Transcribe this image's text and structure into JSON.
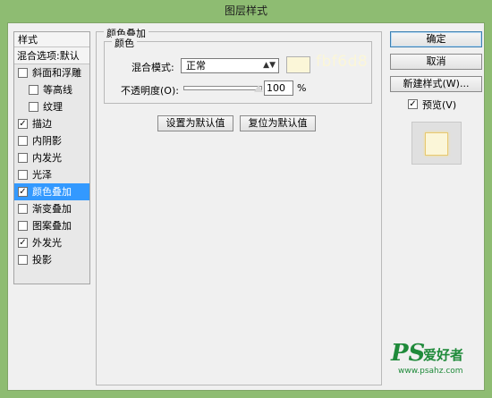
{
  "window": {
    "title": "图层样式"
  },
  "style_list": {
    "header": "样式",
    "blending_options": "混合选项:默认",
    "items": [
      {
        "label": "斜面和浮雕",
        "checked": false,
        "indent": false,
        "selected": false
      },
      {
        "label": "等高线",
        "checked": false,
        "indent": true,
        "selected": false
      },
      {
        "label": "纹理",
        "checked": false,
        "indent": true,
        "selected": false
      },
      {
        "label": "描边",
        "checked": true,
        "indent": false,
        "selected": false
      },
      {
        "label": "内阴影",
        "checked": false,
        "indent": false,
        "selected": false
      },
      {
        "label": "内发光",
        "checked": false,
        "indent": false,
        "selected": false
      },
      {
        "label": "光泽",
        "checked": false,
        "indent": false,
        "selected": false
      },
      {
        "label": "颜色叠加",
        "checked": true,
        "indent": false,
        "selected": true
      },
      {
        "label": "渐变叠加",
        "checked": false,
        "indent": false,
        "selected": false
      },
      {
        "label": "图案叠加",
        "checked": false,
        "indent": false,
        "selected": false
      },
      {
        "label": "外发光",
        "checked": true,
        "indent": false,
        "selected": false
      },
      {
        "label": "投影",
        "checked": false,
        "indent": false,
        "selected": false
      }
    ]
  },
  "color_overlay": {
    "group_title": "颜色叠加",
    "subgroup_title": "颜色",
    "blend_mode_label": "混合模式:",
    "blend_mode_value": "正常",
    "color_hex": "fbf6d8",
    "opacity_label": "不透明度(O):",
    "opacity_value": "100",
    "opacity_unit": "%",
    "opacity_level": 1.0,
    "set_default_label": "设置为默认值",
    "reset_default_label": "复位为默认值"
  },
  "actions": {
    "ok_label": "确定",
    "cancel_label": "取消",
    "new_style_label": "新建样式(W)...",
    "preview_label": "预览(V)",
    "preview_checked": true
  },
  "colors": {
    "overlay": "#fbf6d8",
    "selection": "#3399ff",
    "window_frame": "#8ebc72"
  },
  "watermark": {
    "logo": "PS",
    "text": "爱好者",
    "url": "www.psahz.com"
  }
}
